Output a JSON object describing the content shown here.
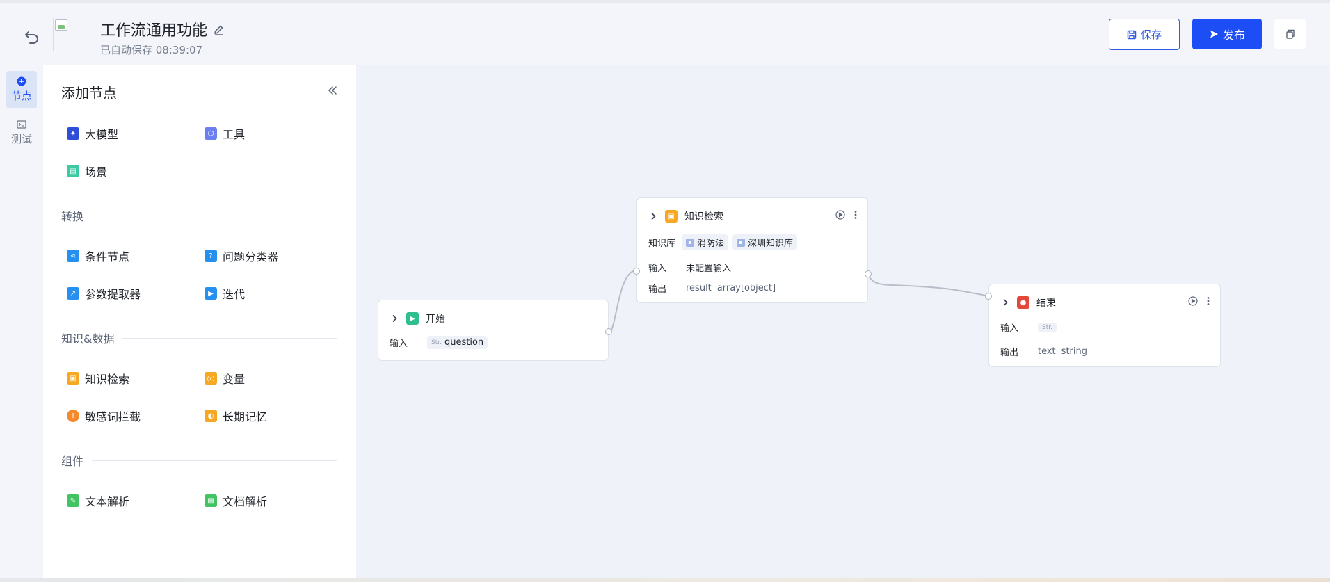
{
  "header": {
    "title": "工作流通用功能",
    "autosave": "已自动保存 08:39:07",
    "save_label": "保存",
    "publish_label": "发布"
  },
  "rail": {
    "items": [
      {
        "label": "节点",
        "active": true
      },
      {
        "label": "测试",
        "active": false
      }
    ]
  },
  "panel": {
    "title": "添加节点",
    "basic": [
      {
        "label": "大模型",
        "icon": "model-icon",
        "color": "#2d4fd8"
      },
      {
        "label": "工具",
        "icon": "tool-icon",
        "color": "#6b7ff0"
      },
      {
        "label": "场景",
        "icon": "scene-icon",
        "color": "#3ec9a5"
      }
    ],
    "sections": [
      {
        "title": "转换",
        "items": [
          {
            "label": "条件节点",
            "icon": "condition-icon",
            "color": "#2590f0"
          },
          {
            "label": "问题分类器",
            "icon": "classifier-icon",
            "color": "#2590f0"
          },
          {
            "label": "参数提取器",
            "icon": "extractor-icon",
            "color": "#2590f0"
          },
          {
            "label": "迭代",
            "icon": "iteration-icon",
            "color": "#2590f0"
          }
        ]
      },
      {
        "title": "知识&数据",
        "items": [
          {
            "label": "知识检索",
            "icon": "knowledge-icon",
            "color": "#f7a823"
          },
          {
            "label": "变量",
            "icon": "variable-icon",
            "color": "#f7a823"
          },
          {
            "label": "敏感词拦截",
            "icon": "shield-icon",
            "color": "#f38b2e"
          },
          {
            "label": "长期记忆",
            "icon": "memory-icon",
            "color": "#f7a823"
          }
        ]
      },
      {
        "title": "组件",
        "items": [
          {
            "label": "文本解析",
            "icon": "text-parse-icon",
            "color": "#43c463"
          },
          {
            "label": "文档解析",
            "icon": "doc-parse-icon",
            "color": "#43c463"
          }
        ]
      }
    ]
  },
  "canvas": {
    "start_node": {
      "title": "开始",
      "input_label": "输入",
      "input_type": "Str.",
      "input_value": "question"
    },
    "knowledge_node": {
      "title": "知识检索",
      "kb_label": "知识库",
      "kb_tags": [
        "消防法",
        "深圳知识库"
      ],
      "input_label": "输入",
      "input_value": "未配置输入",
      "output_label": "输出",
      "output_name": "result",
      "output_type": "array[object]"
    },
    "end_node": {
      "title": "结束",
      "input_label": "输入",
      "input_type": "Str.",
      "output_label": "输出",
      "output_name": "text",
      "output_type": "string"
    }
  },
  "colors": {
    "accent": "#1d4ef5",
    "start": "#2fbf8f",
    "knowledge": "#f7a823",
    "end": "#e5483b"
  }
}
